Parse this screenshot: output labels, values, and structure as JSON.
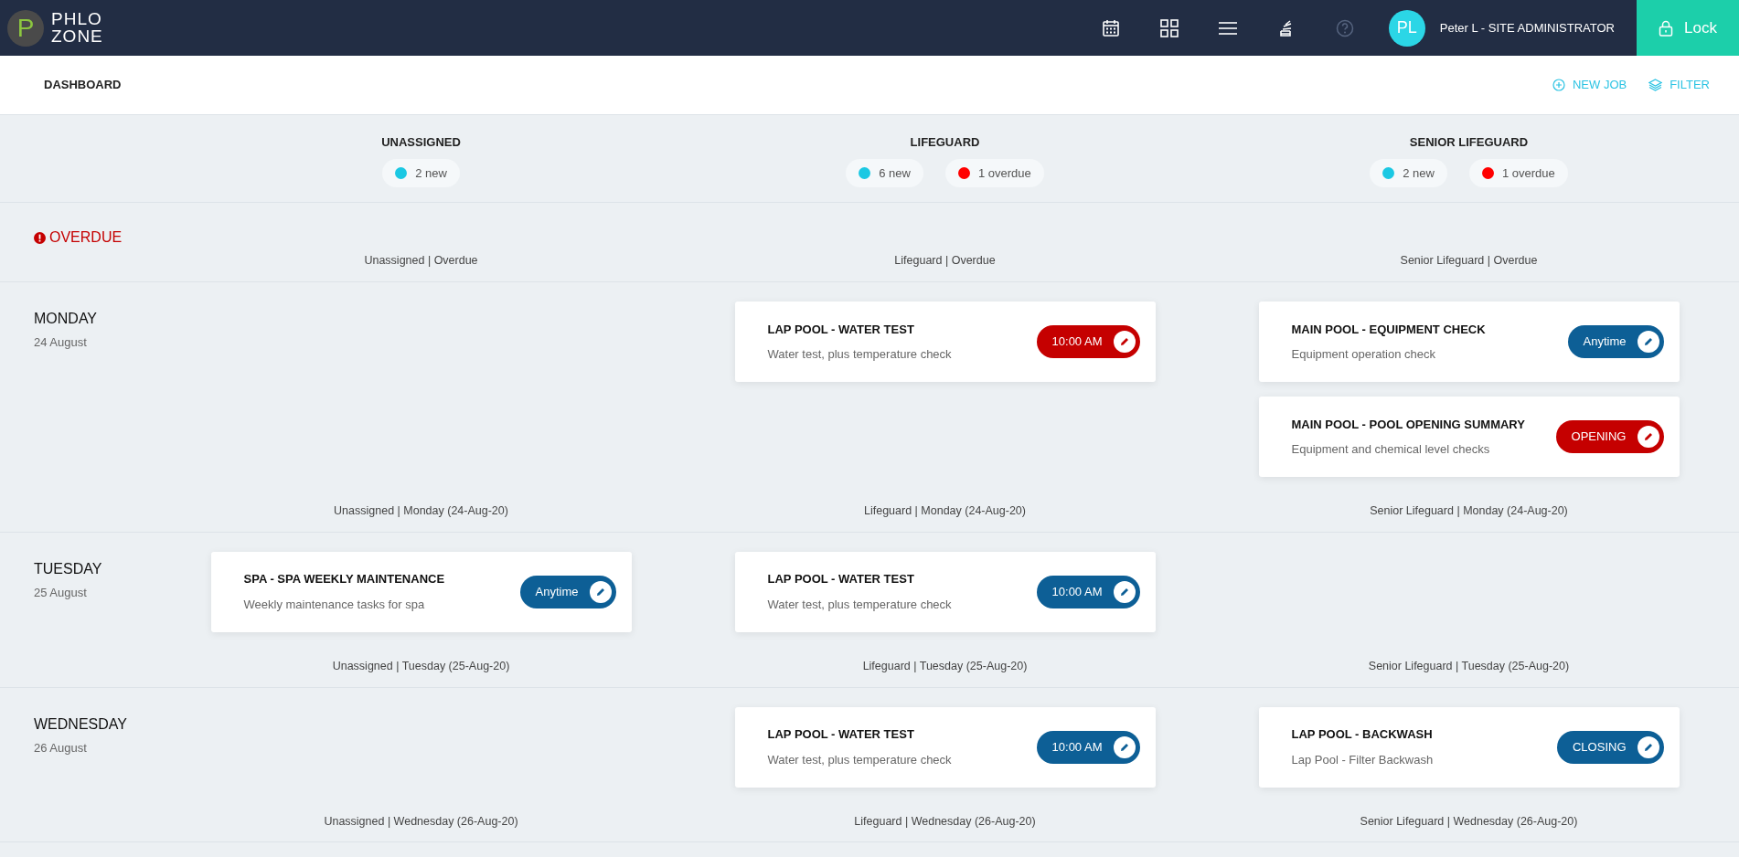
{
  "header": {
    "logo": {
      "mark": "P",
      "line1": "PHLO",
      "line2": "ZONE"
    },
    "nav_icons": [
      {
        "kind": "calendar"
      },
      {
        "kind": "grid"
      },
      {
        "kind": "menu"
      },
      {
        "kind": "stack"
      },
      {
        "kind": "help"
      }
    ],
    "user": {
      "initials": "PL",
      "name": "Peter L - SITE ADMINISTRATOR"
    },
    "lock_button": "Lock"
  },
  "toolbar": {
    "title": "DASHBOARD",
    "actions": [
      {
        "kind": "add",
        "label": "NEW JOB"
      },
      {
        "kind": "layers",
        "label": "FILTER"
      }
    ]
  },
  "summary": [
    {
      "title": "UNASSIGNED",
      "counts": [
        {
          "label": "2 new",
          "color": "#1bc8e3"
        }
      ]
    },
    {
      "title": "LIFEGUARD",
      "counts": [
        {
          "label": "6 new",
          "color": "#1bc8e3"
        },
        {
          "label": "1 overdue",
          "color": "#ff0000"
        }
      ]
    },
    {
      "title": "SENIOR LIFEGUARD",
      "counts": [
        {
          "label": "2 new",
          "color": "#1bc8e3"
        },
        {
          "label": "1 overdue",
          "color": "#ff0000"
        }
      ]
    }
  ],
  "sections": [
    {
      "kind": "overdue",
      "title": "OVERDUE",
      "footers": [
        "Unassigned | Overdue",
        "Lifeguard | Overdue",
        "Senior Lifeguard | Overdue"
      ],
      "columns": [
        [],
        [],
        []
      ]
    },
    {
      "kind": "day",
      "title": "MONDAY",
      "date": "24 August",
      "footers": [
        "Unassigned | Monday (24-Aug-20)",
        "Lifeguard | Monday (24-Aug-20)",
        "Senior Lifeguard | Monday (24-Aug-20)"
      ],
      "columns": [
        [],
        [
          {
            "title": "LAP POOL - WATER TEST",
            "description": "Water test, plus temperature check",
            "time": "10:00 AM",
            "overdue": true
          }
        ],
        [
          {
            "title": "MAIN POOL - EQUIPMENT CHECK",
            "description": "Equipment operation check",
            "time": "Anytime",
            "overdue": false
          },
          {
            "title": "MAIN POOL - POOL OPENING SUMMARY",
            "description": "Equipment and chemical level checks",
            "time": "OPENING",
            "overdue": true
          }
        ]
      ]
    },
    {
      "kind": "day",
      "title": "TUESDAY",
      "date": "25 August",
      "footers": [
        "Unassigned | Tuesday (25-Aug-20)",
        "Lifeguard | Tuesday (25-Aug-20)",
        "Senior Lifeguard | Tuesday (25-Aug-20)"
      ],
      "columns": [
        [
          {
            "title": "SPA - SPA WEEKLY MAINTENANCE",
            "description": "Weekly maintenance tasks for spa",
            "time": "Anytime",
            "overdue": false
          }
        ],
        [
          {
            "title": "LAP POOL - WATER TEST",
            "description": "Water test, plus temperature check",
            "time": "10:00 AM",
            "overdue": false
          }
        ],
        []
      ]
    },
    {
      "kind": "day",
      "title": "WEDNESDAY",
      "date": "26 August",
      "footers": [
        "Unassigned | Wednesday (26-Aug-20)",
        "Lifeguard | Wednesday (26-Aug-20)",
        "Senior Lifeguard | Wednesday (26-Aug-20)"
      ],
      "columns": [
        [],
        [
          {
            "title": "LAP POOL - WATER TEST",
            "description": "Water test, plus temperature check",
            "time": "10:00 AM",
            "overdue": false
          }
        ],
        [
          {
            "title": "LAP POOL - BACKWASH",
            "description": "Lap Pool - Filter Backwash",
            "time": "CLOSING",
            "overdue": false
          }
        ]
      ]
    }
  ]
}
